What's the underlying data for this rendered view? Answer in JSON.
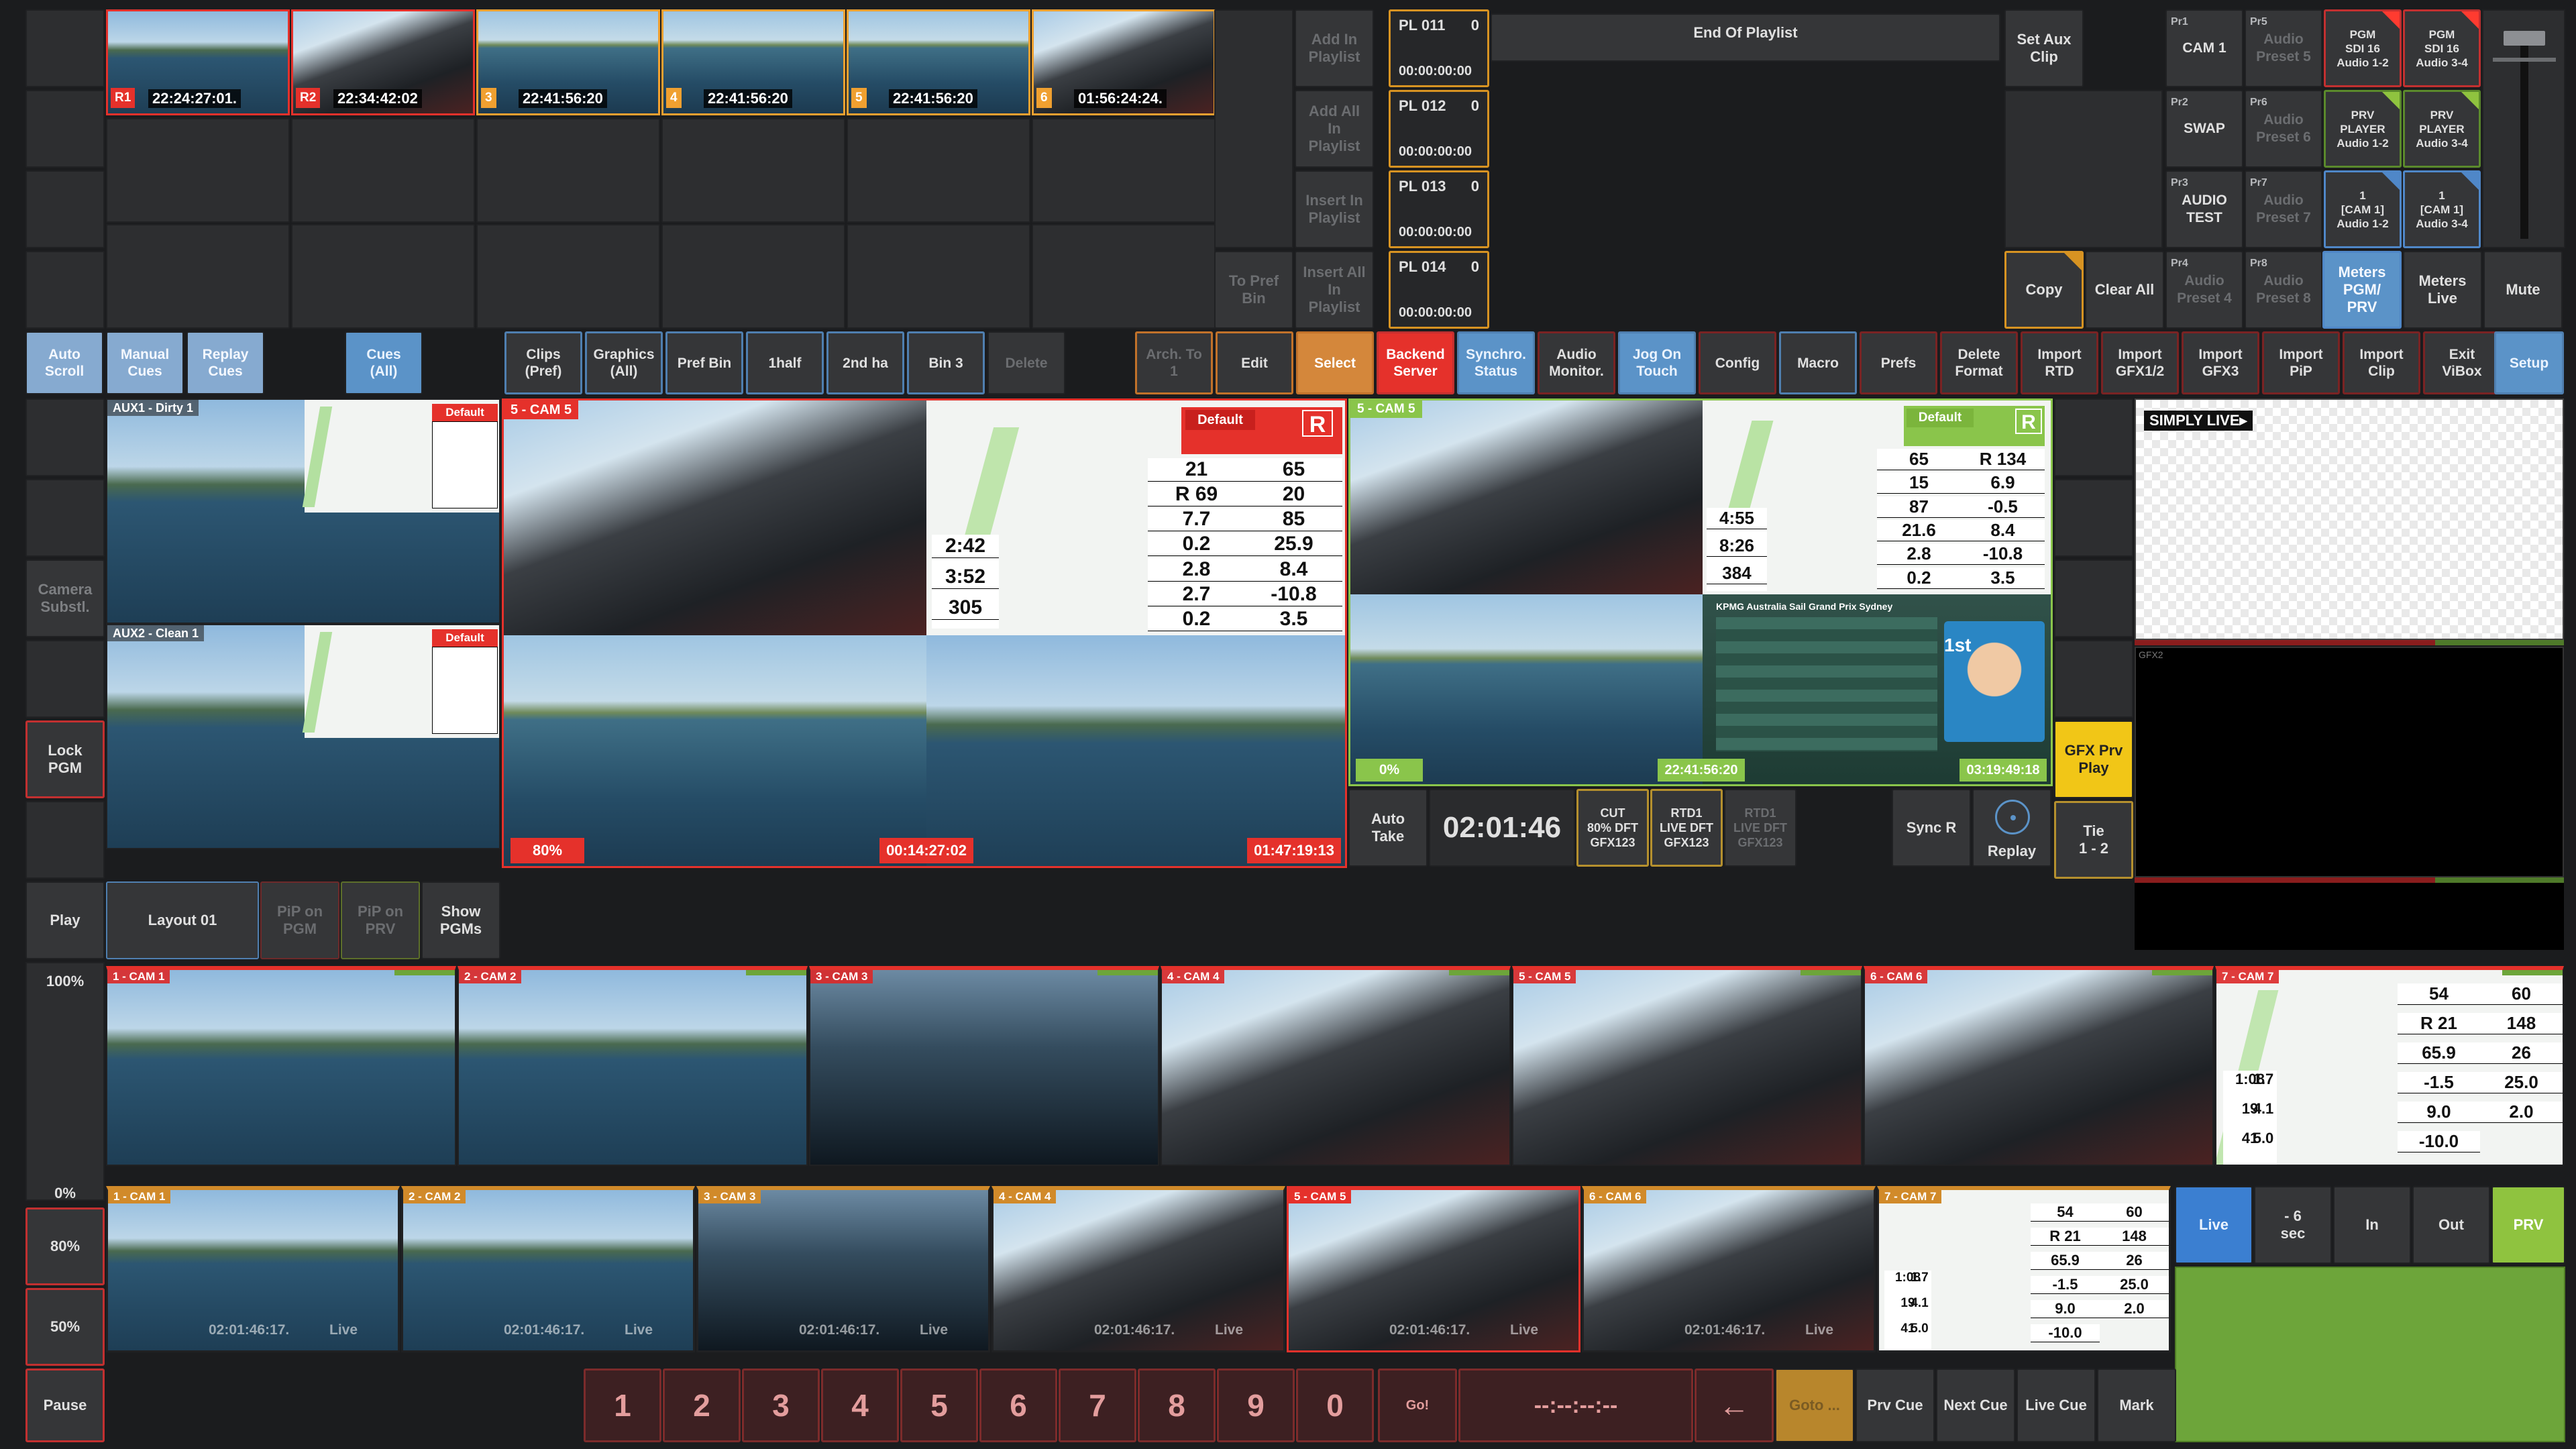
{
  "top_thumbs": [
    {
      "tag": "R1",
      "tc": "22:24:27:01.",
      "color": "#e5312b"
    },
    {
      "tag": "R2",
      "tc": "22:34:42:02",
      "color": "#e5312b"
    },
    {
      "tag": "3",
      "tc": "22:41:56:20",
      "color": "#f0a030"
    },
    {
      "tag": "4",
      "tc": "22:41:56:20",
      "color": "#f0a030"
    },
    {
      "tag": "5",
      "tc": "22:41:56:20",
      "color": "#f0a030"
    },
    {
      "tag": "6",
      "tc": "01:56:24:24.",
      "color": "#f0a030"
    }
  ],
  "playlist": {
    "add_in": "Add In\nPlaylist",
    "add_all_in": "Add All\nIn\nPlaylist",
    "insert_in": "Insert In\nPlaylist",
    "insert_all_in": "Insert All\nIn\nPlaylist",
    "to_pref_bin": "To Pref\nBin",
    "entries": [
      {
        "name": "PL 011",
        "count": "0",
        "tc": "00:00:00:00"
      },
      {
        "name": "PL 012",
        "count": "0",
        "tc": "00:00:00:00"
      },
      {
        "name": "PL 013",
        "count": "0",
        "tc": "00:00:00:00"
      },
      {
        "name": "PL 014",
        "count": "0",
        "tc": "00:00:00:00"
      }
    ],
    "end_label": "End Of Playlist"
  },
  "aux_controls": {
    "set_aux_clip": "Set Aux\nClip",
    "copy": "Copy",
    "clear_all": "Clear All"
  },
  "presets": [
    {
      "pr": "Pr1",
      "label": "CAM 1"
    },
    {
      "pr": "Pr5",
      "label": "Audio\nPreset 5"
    },
    {
      "pr": "Pr2",
      "label": "SWAP"
    },
    {
      "pr": "Pr6",
      "label": "Audio\nPreset 6"
    },
    {
      "pr": "Pr3",
      "label": "AUDIO\nTEST"
    },
    {
      "pr": "Pr7",
      "label": "Audio\nPreset 7"
    },
    {
      "pr": "Pr4",
      "label": "Audio\nPreset 4"
    },
    {
      "pr": "Pr8",
      "label": "Audio\nPreset 8"
    }
  ],
  "outputs": [
    {
      "label": "PGM\nSDI 16\nAudio 1-2"
    },
    {
      "label": "PGM\nSDI 16\nAudio 3-4"
    },
    {
      "label": "PRV\nPLAYER\nAudio 1-2"
    },
    {
      "label": "PRV\nPLAYER\nAudio 3-4"
    },
    {
      "label": "1\n[CAM 1]\nAudio 1-2"
    },
    {
      "label": "1\n[CAM 1]\nAudio 3-4"
    }
  ],
  "meters": {
    "pgm": "Meters\nPGM/\nPRV",
    "live": "Meters\nLive",
    "mute": "Mute"
  },
  "toolbar": [
    {
      "k": "auto_scroll",
      "label": "Auto\nScroll"
    },
    {
      "k": "manual_cues",
      "label": "Manual\nCues"
    },
    {
      "k": "replay_cues",
      "label": "Replay\nCues"
    },
    {
      "k": "cues_all",
      "label": "Cues\n(All)"
    },
    {
      "k": "clips_pref",
      "label": "Clips\n(Pref)"
    },
    {
      "k": "graphics_all",
      "label": "Graphics\n(All)"
    },
    {
      "k": "pref_bin",
      "label": "Pref Bin"
    },
    {
      "k": "1half",
      "label": "1half"
    },
    {
      "k": "2nd_ha",
      "label": "2nd ha"
    },
    {
      "k": "bin3",
      "label": "Bin 3"
    },
    {
      "k": "delete",
      "label": "Delete"
    },
    {
      "k": "arch_to",
      "label": "Arch. To\n1"
    },
    {
      "k": "edit",
      "label": "Edit"
    },
    {
      "k": "select",
      "label": "Select"
    },
    {
      "k": "backend",
      "label": "Backend\nServer"
    },
    {
      "k": "synchro",
      "label": "Synchro.\nStatus"
    },
    {
      "k": "audio_monitor",
      "label": "Audio\nMonitor."
    },
    {
      "k": "jog",
      "label": "Jog On\nTouch"
    },
    {
      "k": "config",
      "label": "Config"
    },
    {
      "k": "macro",
      "label": "Macro"
    },
    {
      "k": "prefs",
      "label": "Prefs"
    },
    {
      "k": "delete_format",
      "label": "Delete\nFormat"
    },
    {
      "k": "import_rtd",
      "label": "Import\nRTD"
    },
    {
      "k": "import_gfx12",
      "label": "Import\nGFX1/2"
    },
    {
      "k": "import_gfx3",
      "label": "Import\nGFX3"
    },
    {
      "k": "import_pip",
      "label": "Import\nPiP"
    },
    {
      "k": "import_clip",
      "label": "Import\nClip"
    },
    {
      "k": "exit_vibox",
      "label": "Exit\nViBox"
    },
    {
      "k": "setup",
      "label": "Setup"
    }
  ],
  "left_column": {
    "camera_subst": "Camera\nSubstl.",
    "lock_pgm": "Lock\nPGM",
    "play": "Play",
    "pct100": "100%",
    "pct0": "0%",
    "pct80": "80%",
    "pct50": "50%",
    "pause": "Pause"
  },
  "aux_mv": {
    "aux1": "AUX1 - Dirty 1",
    "aux2": "AUX2 - Clean 1",
    "default": "Default"
  },
  "pgm": {
    "label": "5 - CAM 5",
    "pct": "80%",
    "tc1": "00:14:27:02",
    "tc2": "01:47:19:13",
    "default": "Default",
    "r": "R",
    "nums": [
      "21",
      "65",
      "R 69",
      "20",
      "7.7",
      "85",
      "0.2",
      "25.9",
      "2.8",
      "8.4",
      "2.7",
      "-10.8",
      "0.2",
      "3.5",
      "2:42",
      "3:52",
      "305"
    ]
  },
  "prv": {
    "label": "5 - CAM 5",
    "pct": "0%",
    "tc1": "22:41:56:20",
    "tc2": "03:19:49:18",
    "default": "Default",
    "r": "R",
    "nums": [
      "65",
      "R 134",
      "15",
      "6.9",
      "87",
      "-0.5",
      "21.6",
      "8.4",
      "2.8",
      "-10.8",
      "0.2",
      "3.5",
      "4:55",
      "8:26",
      "384"
    ],
    "leaderboard": "KPMG Australia Sail Grand Prix Sydney",
    "rank": "1st"
  },
  "simply_live": "SIMPLY LIVE▸",
  "gfx2": "GFX2",
  "gfx_prv_play": "GFX Prv\nPlay",
  "transport": {
    "auto_take": "Auto\nTake",
    "clock": "02:01:46",
    "cut": "CUT\n80% DFT\nGFX123",
    "rtd1_live": "RTD1\nLIVE DFT\nGFX123",
    "rtd1_live2": "RTD1\nLIVE DFT\nGFX123",
    "sync_r": "Sync R",
    "replay": "Replay",
    "tie": "Tie\n1 - 2"
  },
  "layout_row": {
    "layout": "Layout 01",
    "pip_pgm": "PiP on\nPGM",
    "pip_prv": "PiP on\nPRV",
    "show_pgms": "Show\nPGMs"
  },
  "cams_top": [
    {
      "label": "1 - CAM 1"
    },
    {
      "label": "2 - CAM 2"
    },
    {
      "label": "3 - CAM 3"
    },
    {
      "label": "4 - CAM 4"
    },
    {
      "label": "5 - CAM 5"
    },
    {
      "label": "6 - CAM 6"
    },
    {
      "label": "7 - CAM 7",
      "nums": [
        "54",
        "60",
        "R 21",
        "148",
        "65.9",
        "26",
        "-1.5",
        "25.0",
        "9.0",
        "2.0",
        "-10.0",
        "1:08",
        "19",
        "41",
        "1.7",
        "4.1",
        "5.0"
      ]
    }
  ],
  "cams_bottom": [
    {
      "label": "1 - CAM 1",
      "tc": "02:01:46:17.",
      "live": "Live"
    },
    {
      "label": "2 - CAM 2",
      "tc": "02:01:46:17.",
      "live": "Live"
    },
    {
      "label": "3 - CAM 3",
      "tc": "02:01:46:17.",
      "live": "Live"
    },
    {
      "label": "4 - CAM 4",
      "tc": "02:01:46:17.",
      "live": "Live"
    },
    {
      "label": "5 - CAM 5",
      "tc": "02:01:46:17.",
      "live": "Live"
    },
    {
      "label": "6 - CAM 6",
      "tc": "02:01:46:17.",
      "live": "Live"
    },
    {
      "label": "7 - CAM 7",
      "nums": [
        "54",
        "60",
        "R 21",
        "148",
        "65.9",
        "26",
        "-1.5",
        "25.0",
        "9.0",
        "2.0",
        "-10.0",
        "1:08",
        "19",
        "41",
        "1.7",
        "4.1",
        "5.0"
      ]
    }
  ],
  "right_mini": {
    "live": "Live",
    "minus6": "- 6\nsec",
    "in": "In",
    "out": "Out",
    "prv": "PRV"
  },
  "keypad": {
    "keys": [
      "1",
      "2",
      "3",
      "4",
      "5",
      "6",
      "7",
      "8",
      "9",
      "0"
    ],
    "go": "Go!",
    "tc": "--:--:--:--",
    "back": "←",
    "goto": "Goto ...",
    "prv_cue": "Prv Cue",
    "next_cue": "Next Cue",
    "live_cue": "Live Cue",
    "mark": "Mark"
  },
  "colors": {
    "accent_blue": "#5b93c8",
    "red": "#e5312b",
    "orange": "#d4873b",
    "green": "#84c043",
    "yellow": "#f1c617"
  }
}
